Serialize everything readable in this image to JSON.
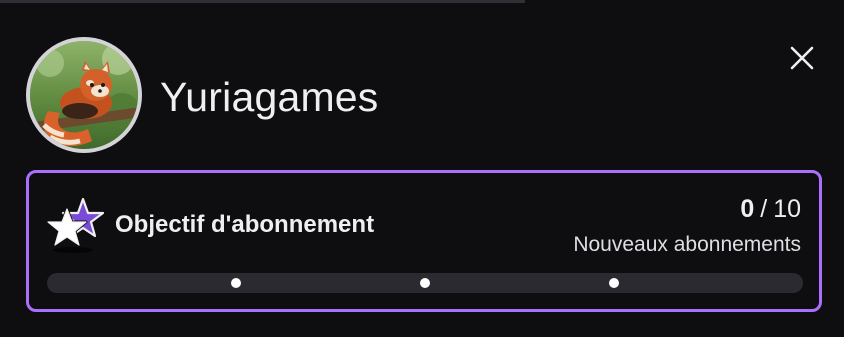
{
  "channel": {
    "name": "Yuriagames"
  },
  "goal": {
    "title": "Objectif d'abonnement",
    "current": "0",
    "separator": "/",
    "target": "10",
    "subtitle": "Nouveaux abonnements",
    "progress_fraction": 0,
    "milestones": [
      0.25,
      0.5,
      0.75
    ]
  },
  "icons": {
    "close": "close-icon",
    "goal": "sub-star-icon",
    "avatar": "red-panda-avatar"
  },
  "colors": {
    "background": "#0e0e10",
    "accent": "#a970ff",
    "track": "#2a2a30",
    "text": "#efeff1"
  }
}
